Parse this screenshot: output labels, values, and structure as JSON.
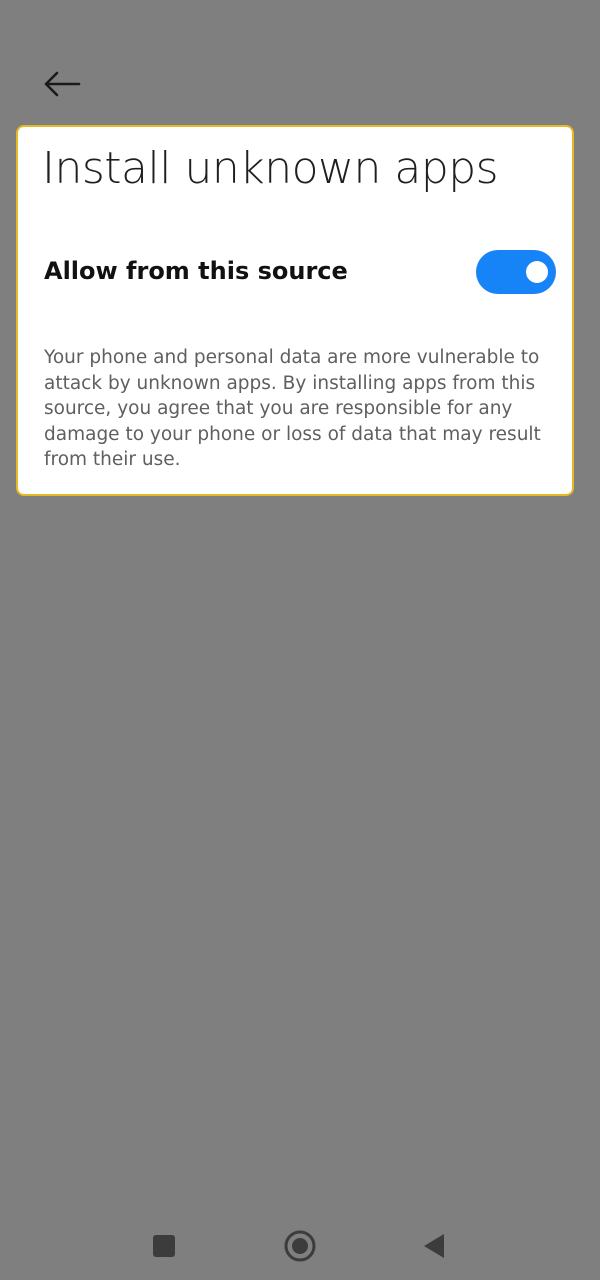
{
  "header": {
    "back_icon": "arrow-left-icon"
  },
  "card": {
    "title": "Install unknown apps",
    "setting": {
      "label": "Allow from this source",
      "enabled": true,
      "toggle_color": "#1683f7"
    },
    "description": "Your phone and personal data are more vulnerable to attack by unknown apps. By installing apps from this source, you agree that you are responsible for any damage to your phone or loss of data that may result from their use.",
    "highlight_color": "#e6b824"
  },
  "nav_bar": {
    "recents_icon": "square-icon",
    "home_icon": "circle-home-icon",
    "back_icon": "triangle-back-icon"
  }
}
